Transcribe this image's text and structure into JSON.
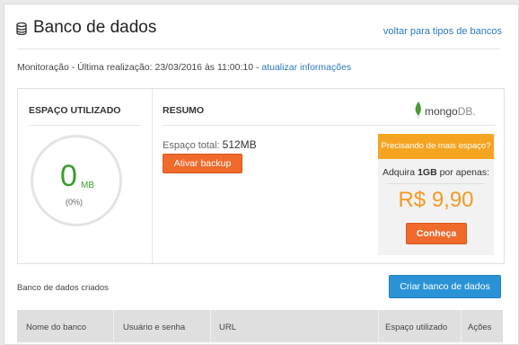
{
  "header": {
    "title": "Banco de dados",
    "back_link": "voltar para tipos de bancos"
  },
  "monitor": {
    "text": "Monitoração - Última realização: 23/03/2016 às 11:00:10 - ",
    "link": "atualizar informações"
  },
  "usage": {
    "label": "ESPAÇO UTILIZADO",
    "value": "0",
    "unit": "MB",
    "percent": "(0%)",
    "fraction_used": 0
  },
  "summary": {
    "label": "RESUMO",
    "logo_text": "mongo",
    "logo_text_suffix": "DB.",
    "total_label": "Espaço total: ",
    "total_value": "512MB",
    "backup_button": "Ativar backup"
  },
  "promo": {
    "header": "Precisando de mais espaço?",
    "buy_prefix": "Adquira ",
    "buy_amount": "1GB",
    "buy_suffix": " por apenas:",
    "price": "R$ 9,90",
    "button": "Conheça"
  },
  "databases": {
    "label": "Banco de dados criados",
    "create_button": "Criar banco de dados",
    "columns": [
      "Nome do banco",
      "Usuário e senha",
      "URL",
      "Espaço utilizado",
      "Ações"
    ]
  },
  "colors": {
    "accent_orange": "#ef6a2b",
    "promo_yellow": "#f5a421",
    "price_orange": "#f39a21",
    "link_blue": "#2a78c2",
    "button_blue": "#2a93d6",
    "usage_green": "#3a9e2a"
  }
}
